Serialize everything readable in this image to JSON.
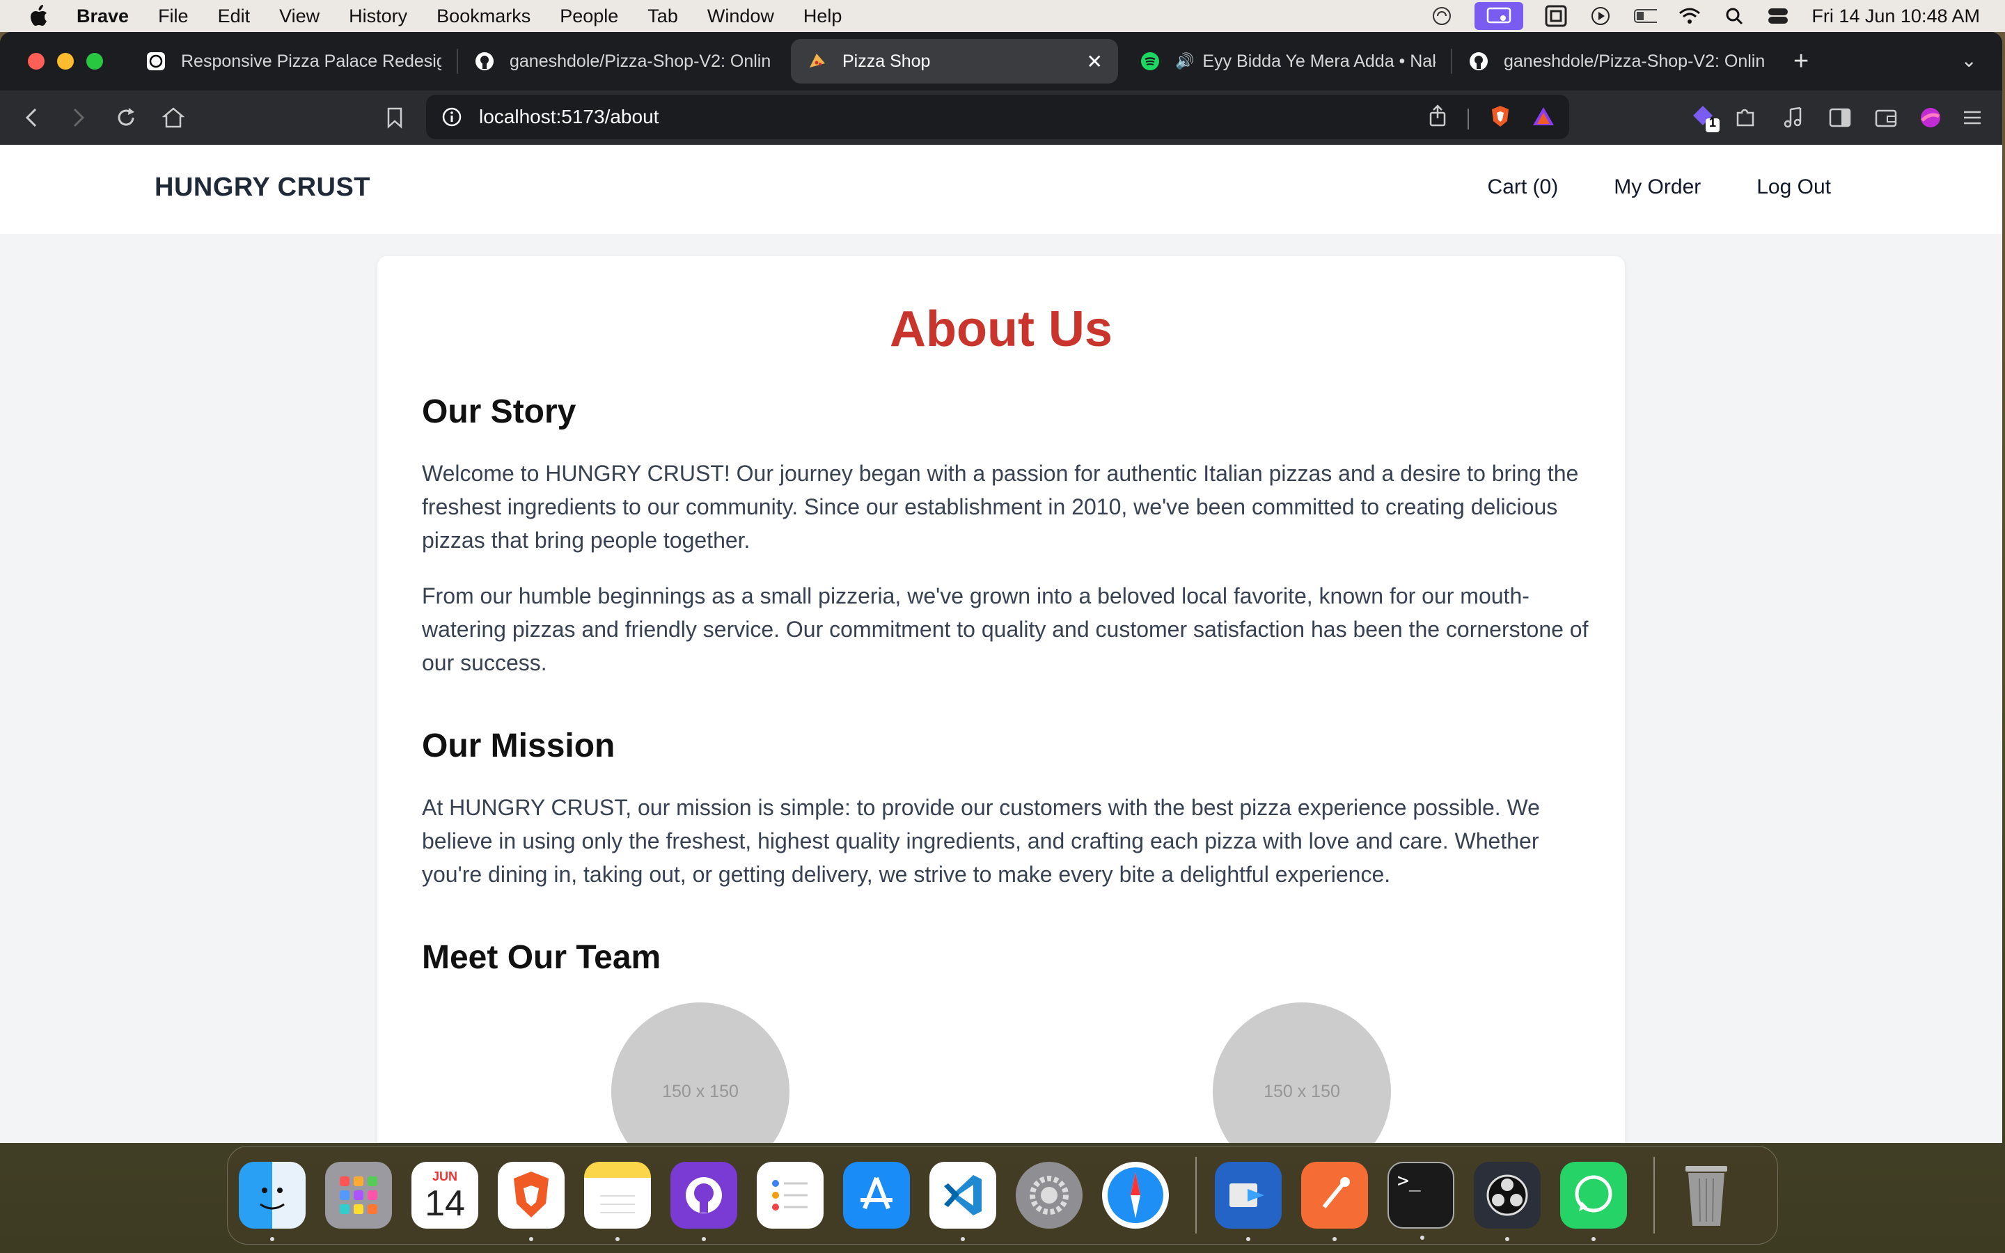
{
  "menubar": {
    "app_name": "Brave",
    "menus": [
      "File",
      "Edit",
      "View",
      "History",
      "Bookmarks",
      "People",
      "Tab",
      "Window",
      "Help"
    ],
    "clock": "Fri 14 Jun  10:48 AM"
  },
  "tabs": [
    {
      "title": "Responsive Pizza Palace Redesign",
      "icon": "openai-icon",
      "active": false
    },
    {
      "title": "ganeshdole/Pizza-Shop-V2: Onlin",
      "icon": "github-icon",
      "active": false
    },
    {
      "title": "Pizza Shop",
      "icon": "pizza-icon",
      "active": true
    },
    {
      "title": "Eyy Bidda Ye Mera Adda • Nak",
      "icon": "spotify-icon",
      "active": false
    },
    {
      "title": "ganeshdole/Pizza-Shop-V2: Onlin",
      "icon": "github-icon",
      "active": false
    }
  ],
  "address_bar": {
    "url": "localhost:5173/about"
  },
  "extension_badge": "1",
  "site": {
    "brand": "HUNGRY CRUST",
    "nav": {
      "cart": "Cart (0)",
      "orders": "My Order",
      "logout": "Log Out"
    }
  },
  "about": {
    "title": "About Us",
    "story_heading": "Our Story",
    "story_p1": "Welcome to HUNGRY CRUST! Our journey began with a passion for authentic Italian pizzas and a desire to bring the freshest ingredients to our community. Since our establishment in 2010, we've been committed to creating delicious pizzas that bring people together.",
    "story_p2": "From our humble beginnings as a small pizzeria, we've grown into a beloved local favorite, known for our mouth-watering pizzas and friendly service. Our commitment to quality and customer satisfaction has been the cornerstone of our success.",
    "mission_heading": "Our Mission",
    "mission_p": "At HUNGRY CRUST, our mission is simple: to provide our customers with the best pizza experience possible. We believe in using only the freshest, highest quality ingredients, and crafting each pizza with love and care. Whether you're dining in, taking out, or getting delivery, we strive to make every bite a delightful experience.",
    "team_heading": "Meet Our Team",
    "team_placeholders": [
      "150 x 150",
      "150 x 150"
    ]
  },
  "dock": {
    "calendar_month": "JUN",
    "calendar_day": "14",
    "apps": [
      "finder",
      "launchpad",
      "calendar",
      "brave",
      "notes",
      "github-desktop",
      "reminders",
      "app-store",
      "vscode",
      "system-settings",
      "safari",
      "migration",
      "postman",
      "terminal",
      "obs",
      "whatsapp",
      "trash"
    ]
  }
}
